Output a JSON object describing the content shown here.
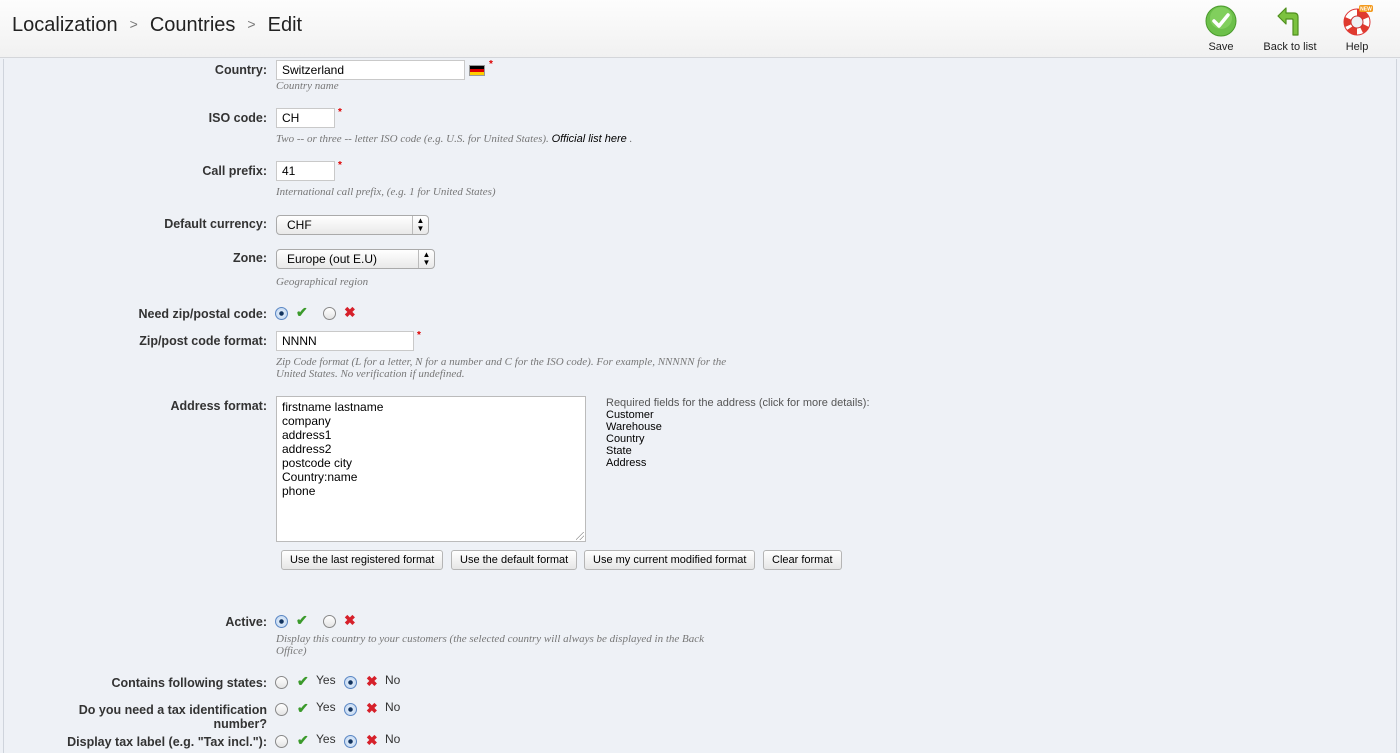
{
  "breadcrumb": {
    "items": [
      "Localization",
      "Countries",
      "Edit"
    ],
    "separator": ">"
  },
  "toolbar": {
    "save_label": "Save",
    "back_label": "Back to list",
    "help_label": "Help",
    "help_badge": "NEW"
  },
  "form": {
    "country": {
      "label": "Country:",
      "value": "Switzerland",
      "hint": "Country name",
      "flag_icon": "germany-flag-icon"
    },
    "iso_code": {
      "label": "ISO code:",
      "value": "CH",
      "hint": "Two -- or three -- letter ISO code (e.g. U.S. for United States).",
      "link": "Official list here",
      "hint_end": "."
    },
    "call_prefix": {
      "label": "Call prefix:",
      "value": "41",
      "hint": "International call prefix, (e.g. 1 for United States)"
    },
    "default_currency": {
      "label": "Default currency:",
      "selected": "CHF"
    },
    "zone": {
      "label": "Zone:",
      "selected": "Europe (out E.U)",
      "hint": "Geographical region"
    },
    "need_zip": {
      "label": "Need zip/postal code:",
      "selected": "yes"
    },
    "zip_format": {
      "label": "Zip/post code format:",
      "value": "NNNN",
      "hint_line1": "Zip Code format (L for a letter, N for a number and C for the ISO code). For example, NNNNN for the",
      "hint_line2": "United States. No verification if undefined."
    },
    "address_format": {
      "label": "Address format:",
      "lines": [
        "firstname lastname",
        "company",
        "address1",
        "address2",
        "postcode city",
        "Country:name",
        "phone"
      ],
      "required_title": "Required fields for the address (click for more details):",
      "required_fields": [
        "Customer",
        "Warehouse",
        "Country",
        "State",
        "Address"
      ],
      "buttons": {
        "last_registered": "Use the last registered format",
        "default": "Use the default format",
        "current_modified": "Use my current modified format",
        "clear": "Clear format"
      }
    },
    "active": {
      "label": "Active:",
      "selected": "yes",
      "hint_line1": "Display this country to your customers (the selected country will always be displayed in the Back",
      "hint_line2": "Office)"
    },
    "contains_states": {
      "label": "Contains following states:",
      "yes_label": "Yes",
      "no_label": "No",
      "selected": "no"
    },
    "tax_id": {
      "label_line1": "Do you need a tax identification",
      "label_line2": "number?",
      "yes_label": "Yes",
      "no_label": "No",
      "selected": "no"
    },
    "tax_label": {
      "label": "Display tax label (e.g. \"Tax incl.\"):",
      "yes_label": "Yes",
      "no_label": "No",
      "selected": "no"
    }
  },
  "colors": {
    "check": "#3b9a2b",
    "cross": "#d6202a",
    "required": "#d00000",
    "background": "#eef1f6"
  }
}
